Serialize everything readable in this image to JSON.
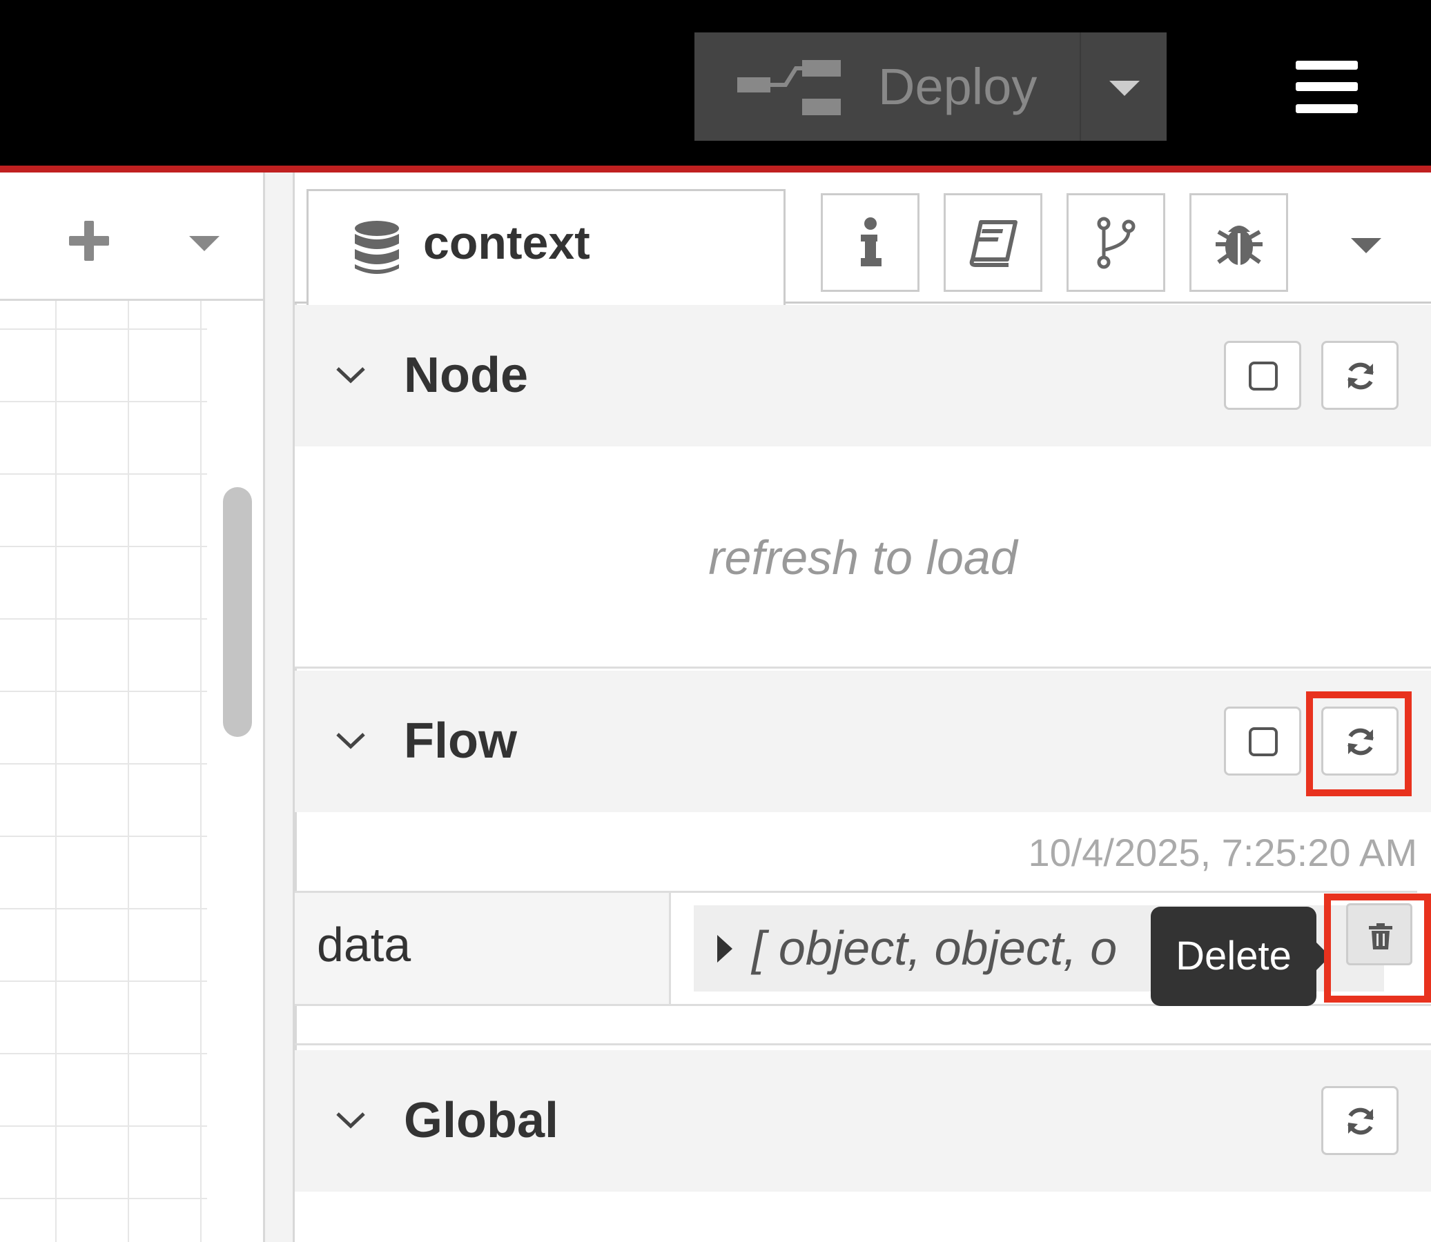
{
  "header": {
    "deploy_label": "Deploy",
    "deploy_icon": "deploy-flow-icon",
    "menu_icon": "hamburger-icon"
  },
  "workspace": {
    "add_icon": "plus-icon",
    "menu_icon": "caret-down-icon"
  },
  "sidebar": {
    "active_tab": {
      "label": "context",
      "icon": "database-icon"
    },
    "tabs": [
      {
        "name": "info",
        "icon": "info-icon"
      },
      {
        "name": "help",
        "icon": "book-icon"
      },
      {
        "name": "changes",
        "icon": "git-branch-icon"
      },
      {
        "name": "debug",
        "icon": "bug-icon"
      }
    ],
    "menu_icon": "caret-down-icon"
  },
  "sections": {
    "node": {
      "title": "Node",
      "empty_message": "refresh to load"
    },
    "flow": {
      "title": "Flow",
      "timestamp": "10/4/2025, 7:25:20 AM",
      "rows": [
        {
          "key": "data",
          "value": "[ object, object, o"
        }
      ]
    },
    "global": {
      "title": "Global"
    }
  },
  "tooltip": {
    "text": "Delete"
  },
  "colors": {
    "header_bg": "#000000",
    "accent_red": "#c02020",
    "highlight": "#e8321e",
    "deploy_bg": "#444444"
  }
}
